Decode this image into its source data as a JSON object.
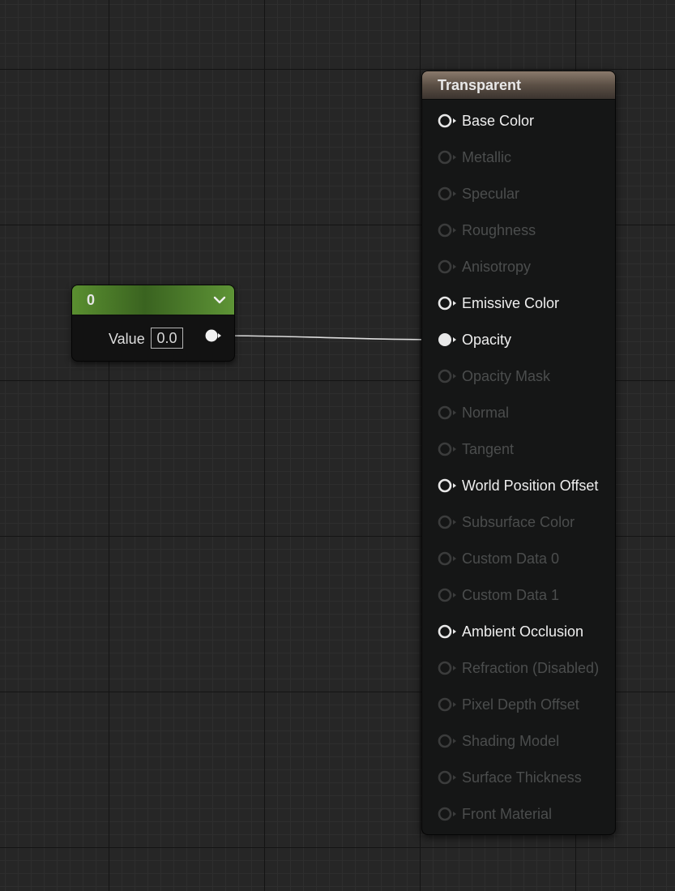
{
  "constant_node": {
    "title": "0",
    "value_label": "Value",
    "value": "0.0"
  },
  "material_node": {
    "title": "Transparent",
    "pins": [
      {
        "label": "Base Color",
        "active": true,
        "connected": false
      },
      {
        "label": "Metallic",
        "active": false,
        "connected": false
      },
      {
        "label": "Specular",
        "active": false,
        "connected": false
      },
      {
        "label": "Roughness",
        "active": false,
        "connected": false
      },
      {
        "label": "Anisotropy",
        "active": false,
        "connected": false
      },
      {
        "label": "Emissive Color",
        "active": true,
        "connected": false
      },
      {
        "label": "Opacity",
        "active": true,
        "connected": true
      },
      {
        "label": "Opacity Mask",
        "active": false,
        "connected": false
      },
      {
        "label": "Normal",
        "active": false,
        "connected": false
      },
      {
        "label": "Tangent",
        "active": false,
        "connected": false
      },
      {
        "label": "World Position Offset",
        "active": true,
        "connected": false
      },
      {
        "label": "Subsurface Color",
        "active": false,
        "connected": false
      },
      {
        "label": "Custom Data 0",
        "active": false,
        "connected": false
      },
      {
        "label": "Custom Data 1",
        "active": false,
        "connected": false
      },
      {
        "label": "Ambient Occlusion",
        "active": true,
        "connected": false
      },
      {
        "label": "Refraction (Disabled)",
        "active": false,
        "connected": false
      },
      {
        "label": "Pixel Depth Offset",
        "active": false,
        "connected": false
      },
      {
        "label": "Shading Model",
        "active": false,
        "connected": false
      },
      {
        "label": "Surface Thickness",
        "active": false,
        "connected": false
      },
      {
        "label": "Front Material",
        "active": false,
        "connected": false
      }
    ]
  },
  "colors": {
    "canvas_bg": "#262626",
    "constant_header": "#4e8a2a",
    "material_header": "#6b5d52",
    "pin_active": "#e6e6e6",
    "pin_inactive": "#3a3a3a",
    "wire": "#dcdcdc"
  }
}
